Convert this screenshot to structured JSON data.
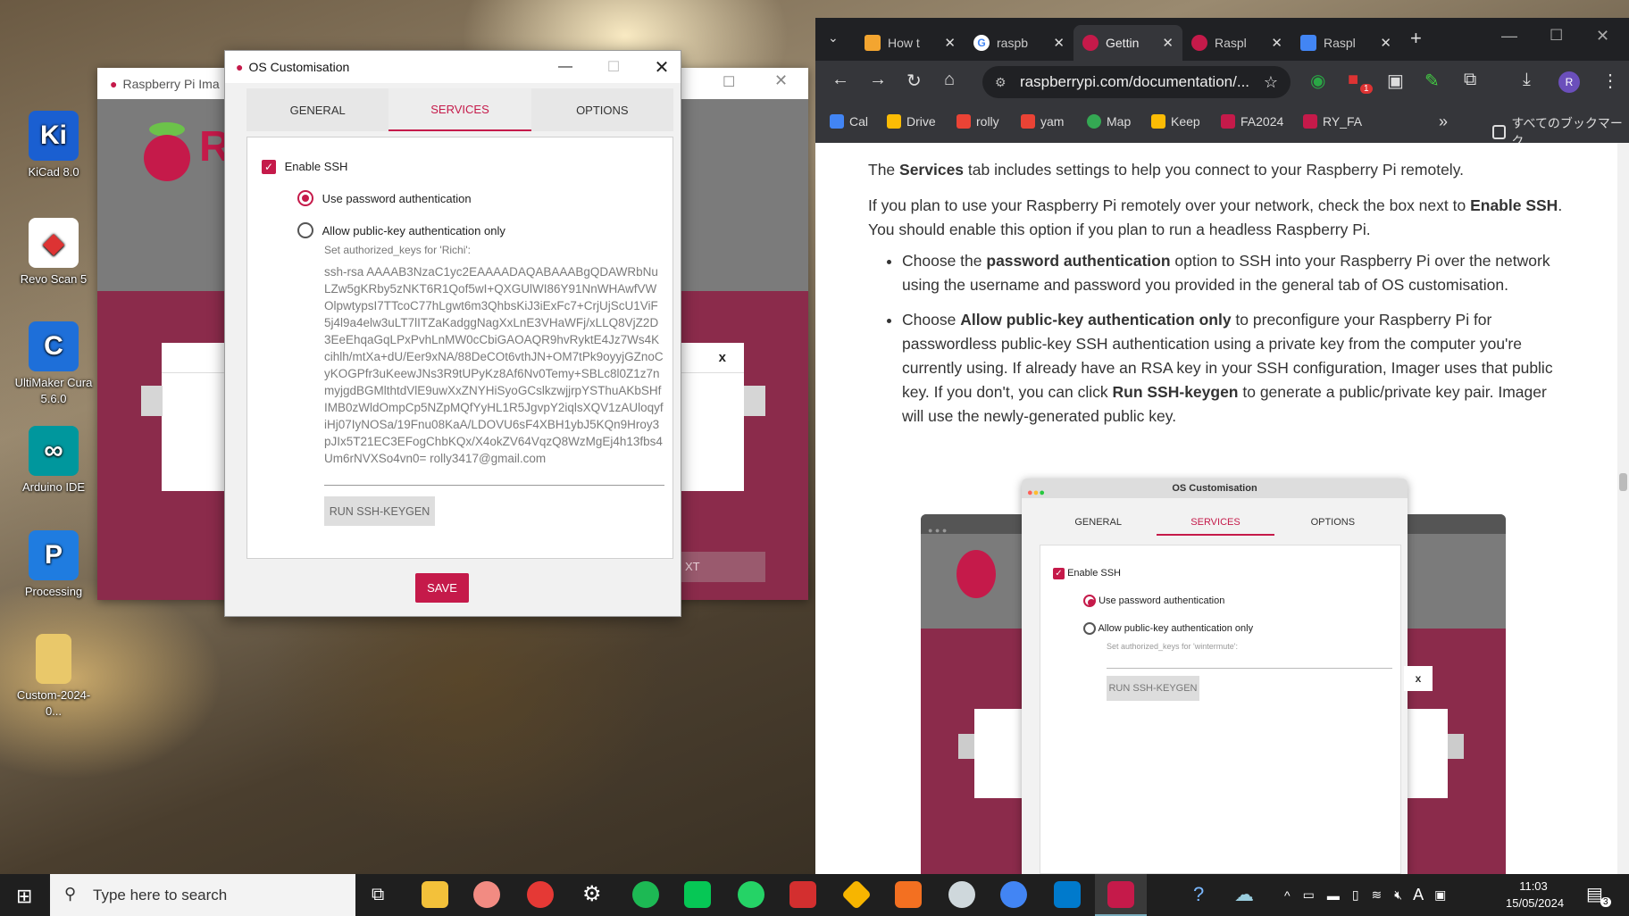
{
  "desktop": {
    "icons": [
      {
        "label": "KiCad 8.0",
        "glyph": "Ki",
        "color": "#1a5fd1"
      },
      {
        "label": "Revo Scan 5",
        "glyph": "◆",
        "color": "#d33"
      },
      {
        "label": "UltiMaker Cura 5.6.0",
        "glyph": "C",
        "color": "#1e6fd9"
      },
      {
        "label": "Arduino IDE",
        "glyph": "∞",
        "color": "#00979d"
      },
      {
        "label": "Processing",
        "glyph": "P",
        "color": "#1f7ce0"
      },
      {
        "label": "Custom-2024-0...",
        "glyph": "",
        "color": "#e9c86a"
      }
    ]
  },
  "imager_window": {
    "title": "Raspberry Pi Ima",
    "close_x": "x",
    "next_fragment": "XT"
  },
  "dialog": {
    "title": "OS Customisation",
    "tabs": [
      "GENERAL",
      "SERVICES",
      "OPTIONS"
    ],
    "enable_ssh": "Enable SSH",
    "option_password": "Use password authentication",
    "option_pubkey": "Allow public-key authentication only",
    "keys_label": "Set authorized_keys for 'Richi':",
    "key_text": "ssh-rsa AAAAB3NzaC1yc2EAAAADAQABAAABgQDAWRbNuLZw5gKRby5zNKT6R1Qof5wI+QXGUlWI86Y91NnWHAwfVWOlpwtypsI7TTcoC77hLgwt6m3QhbsKiJ3iExFc7+CrjUjScU1ViF5j4l9a4elw3uLT7lITZaKadggNagXxLnE3VHaWFj/xLLQ8VjZ2D3EeEhqaGqLPxPvhLnMW0cCbiGAOAQR9hvRyktE4Jz7Ws4Kcihlh/mtXa+dU/Eer9xNA/88DeCOt6vthJN+OM7tPk9oyyjGZnoCyKOGPfr3uKeewJNs3R9tUPyKz8Af6Nv0Temy+SBLc8l0Z1z7nmyjgdBGMlthtdVlE9uwXxZNYHiSyoGCslkzwjjrpYSThuAKbSHfIMB0zWldOmpCp5NZpMQfYyHL1R5JgvpY2iqlsXQV1zAUloqyfiHj07IyNOSa/19Fnu08KaA/LDOVU6sF4XBH1ybJ5KQn9Hroy3pJIx5T21EC3EFogChbKQx/X4okZV64VqzQ8WzMgEj4h13fbs4Um6rNVXSo4vn0= rolly3417@gmail.com",
    "keygen": "RUN SSH-KEYGEN",
    "save": "SAVE"
  },
  "browser": {
    "tabs": [
      "How t",
      "raspb",
      "Gettin",
      "Raspl",
      "Raspl"
    ],
    "url": "raspberrypi.com/documentation/...",
    "bookmarks": [
      "Cal",
      "Drive",
      "rolly",
      "yam",
      "Map",
      "Keep",
      "FA2024",
      "RY_FA"
    ],
    "all_bookmarks": "すべてのブックマーク",
    "profile": "R",
    "ext_badge": "1"
  },
  "article": {
    "p1_a": "The ",
    "p1_b": "Services",
    "p1_c": " tab includes settings to help you connect to your Raspberry Pi remotely.",
    "p2_a": "If you plan to use your Raspberry Pi remotely over your network, check the box next to ",
    "p2_b": "Enable SSH",
    "p2_c": ". You should enable this option if you plan to run a headless Raspberry Pi.",
    "li1_a": "Choose the ",
    "li1_b": "password authentication",
    "li1_c": " option to SSH into your Raspberry Pi over the network using the username and password you provided in the general tab of OS customisation.",
    "li2_a": "Choose ",
    "li2_b": "Allow public-key authentication only",
    "li2_c": " to preconfigure your Raspberry Pi for passwordless public-key SSH authentication using a private key from the computer you're currently using. If already have an RSA key in your SSH configuration, Imager uses that public key. If you don't, you can click ",
    "li2_d": "Run SSH-keygen",
    "li2_e": " to generate a public/private key pair. Imager will use the newly-generated public key."
  },
  "doc_image": {
    "title": "OS Customisation",
    "tabs": [
      "GENERAL",
      "SERVICES",
      "OPTIONS"
    ],
    "enable_ssh": "Enable SSH",
    "option_password": "Use password authentication",
    "option_pubkey": "Allow public-key authentication only",
    "keys_label": "Set authorized_keys for 'wintermute':",
    "keygen": "RUN SSH-KEYGEN",
    "close_x": "x"
  },
  "taskbar": {
    "search_placeholder": "Type here to search",
    "time": "11:03",
    "date": "15/05/2024",
    "ime": "A",
    "notif_count": "3"
  },
  "colors": {
    "accent": "#c51a4a",
    "maroon": "#8b2b4b"
  }
}
